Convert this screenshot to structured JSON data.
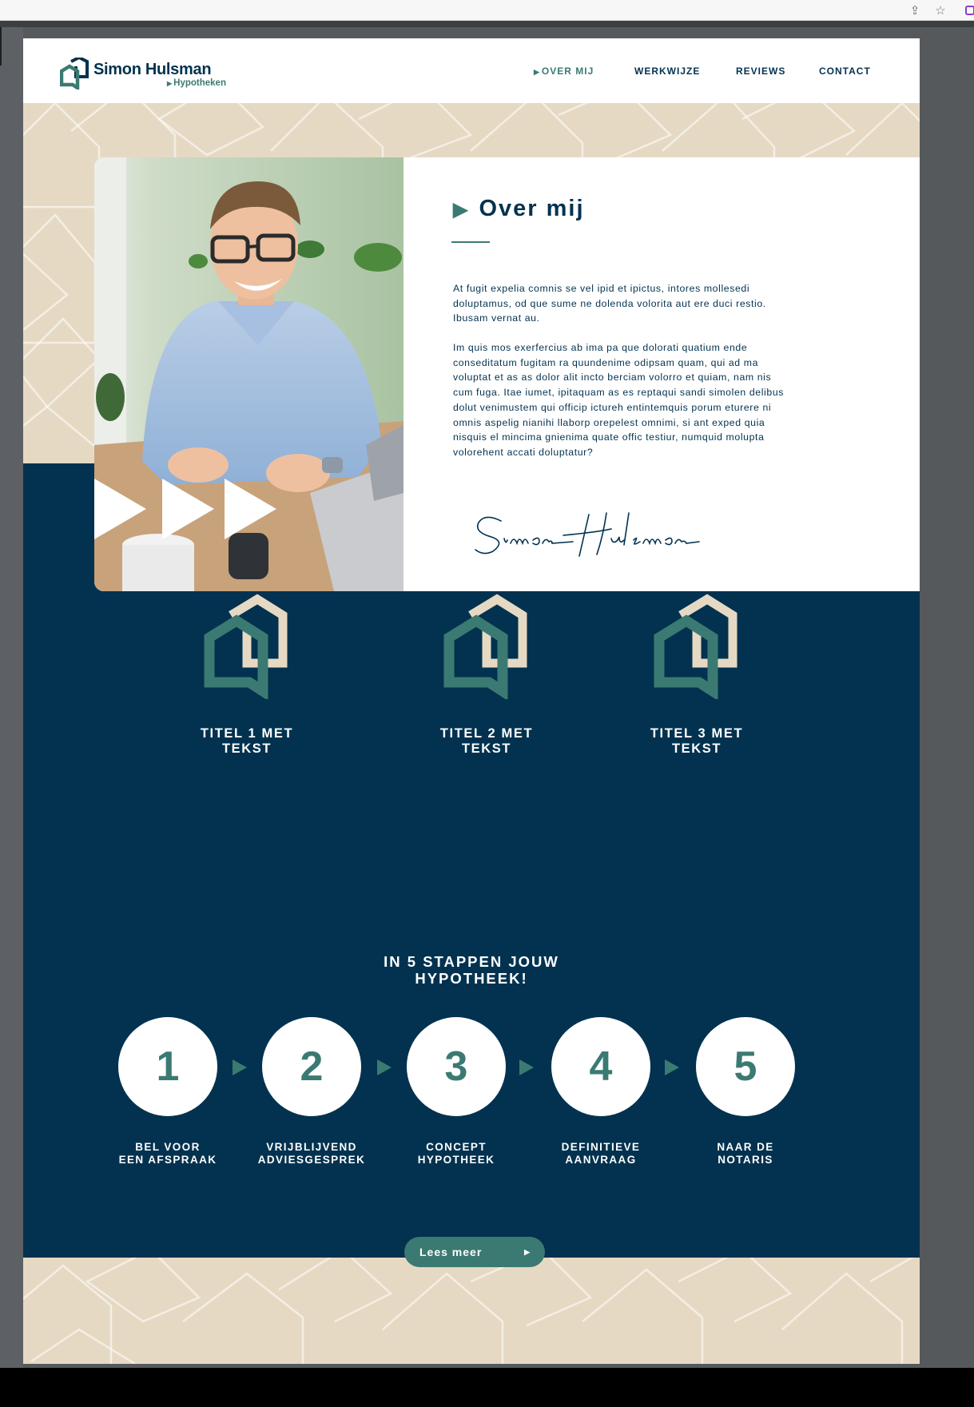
{
  "browser": {
    "share_icon": "share-icon",
    "star_icon": "star-icon",
    "extension_icon": "extension-icon"
  },
  "header": {
    "logo": {
      "name": "Simon Hulsman",
      "sub": "Hypotheken"
    },
    "nav": [
      {
        "label": "OVER MIJ",
        "active": true
      },
      {
        "label": "WERKWIJZE",
        "active": false
      },
      {
        "label": "REVIEWS",
        "active": false
      },
      {
        "label": "CONTACT",
        "active": false
      }
    ]
  },
  "about": {
    "title": "Over mij",
    "paragraphs": [
      "At fugit expelia comnis se vel ipid et ipictus, intores mollesedi doluptamus, od que sume ne dolenda volorita aut ere duci restio. Ibusam vernat au.",
      "Im quis mos exerfercius ab ima pa que dolorati quatium ende conseditatum fugitam ra quundenime odipsam quam, qui ad ma voluptat et as as dolor alit incto berciam volorro et quiam, nam nis cum fuga. Itae iumet, ipitaquam as es reptaqui sandi simolen delibus dolut venimustem qui officip ictureh entintemquis porum eturere ni omnis aspelig nianihi llaborp orepelest omnimi, si ant exped quia nisquis el mincima gnienima quate offic testiur, numquid molupta volorehent accati doluptatur?"
    ],
    "signature": "Simon Hulsman"
  },
  "features": [
    {
      "title_line1": "TITEL 1 MET",
      "title_line2": "TEKST",
      "icon": "house-logo-icon"
    },
    {
      "title_line1": "TITEL 2 MET",
      "title_line2": "TEKST",
      "icon": "house-logo-icon"
    },
    {
      "title_line1": "TITEL 3 MET",
      "title_line2": "TEKST",
      "icon": "house-logo-icon"
    }
  ],
  "steps_section": {
    "title_line1": "IN 5 STAPPEN JOUW",
    "title_line2": "HYPOTHEEK!",
    "steps": [
      {
        "number": "1",
        "line1": "BEL VOOR",
        "line2": "EEN AFSPRAAK"
      },
      {
        "number": "2",
        "line1": "VRIJBLIJVEND",
        "line2": "ADVIESGESPREK"
      },
      {
        "number": "3",
        "line1": "CONCEPT",
        "line2": "HYPOTHEEK"
      },
      {
        "number": "4",
        "line1": "DEFINITIEVE",
        "line2": "AANVRAAG"
      },
      {
        "number": "5",
        "line1": "NAAR DE",
        "line2": "NOTARIS"
      }
    ],
    "button_label": "Lees meer"
  },
  "colors": {
    "navy": "#02324f",
    "teal": "#3b7a72",
    "sand": "#e6d9c4",
    "white": "#ffffff"
  }
}
